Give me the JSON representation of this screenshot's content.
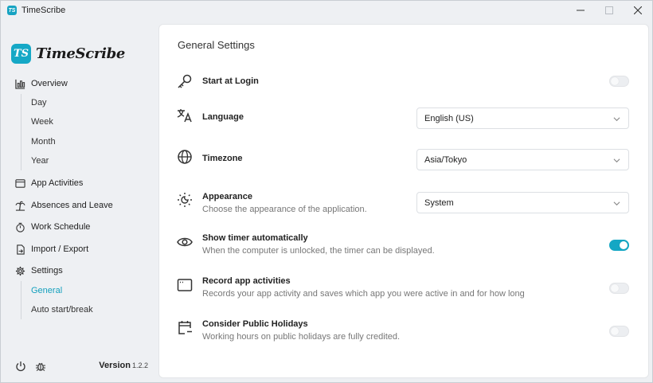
{
  "window": {
    "title": "TimeScribe",
    "icon_text": "TS",
    "controls": [
      "minimize",
      "maximize",
      "close"
    ]
  },
  "brand": {
    "logo_text": "TS",
    "name": "TimeScribe"
  },
  "sidebar": {
    "items": [
      {
        "label": "Overview",
        "icon": "bar-chart-icon"
      },
      {
        "label": "App Activities",
        "icon": "window-icon"
      },
      {
        "label": "Absences and Leave",
        "icon": "palm-tree-icon"
      },
      {
        "label": "Work Schedule",
        "icon": "timer-icon"
      },
      {
        "label": "Import / Export",
        "icon": "file-export-icon"
      },
      {
        "label": "Settings",
        "icon": "gear-icon"
      }
    ],
    "overview_sub": [
      "Day",
      "Week",
      "Month",
      "Year"
    ],
    "settings_sub": [
      {
        "label": "General",
        "active": true
      },
      {
        "label": "Auto start/break",
        "active": false
      }
    ],
    "footer": {
      "icons": [
        "power-icon",
        "bug-icon"
      ],
      "version_label": "Version",
      "version_number": "1.2.2"
    }
  },
  "main": {
    "title": "General Settings",
    "settings": {
      "start_at_login": {
        "label": "Start at Login",
        "enabled": false,
        "icon": "key-icon"
      },
      "language": {
        "label": "Language",
        "value": "English (US)",
        "icon": "translate-icon"
      },
      "timezone": {
        "label": "Timezone",
        "value": "Asia/Tokyo",
        "icon": "globe-icon"
      },
      "appearance": {
        "label": "Appearance",
        "description": "Choose the appearance of the application.",
        "value": "System",
        "icon": "sun-moon-icon"
      },
      "show_timer": {
        "label": "Show timer automatically",
        "description": "When the computer is unlocked, the timer can be displayed.",
        "enabled": true,
        "icon": "eye-icon"
      },
      "record_activities": {
        "label": "Record app activities",
        "description": "Records your app activity and saves which app you were active in and for how long",
        "enabled": false,
        "icon": "app-window-icon"
      },
      "public_holidays": {
        "label": "Consider Public Holidays",
        "description": "Working hours on public holidays are fully credited.",
        "enabled": false,
        "icon": "calendar-minus-icon"
      }
    }
  },
  "colors": {
    "accent": "#14a7c4",
    "active_nav": "#14a0bd",
    "background": "#eef0f3",
    "panel": "#ffffff"
  }
}
